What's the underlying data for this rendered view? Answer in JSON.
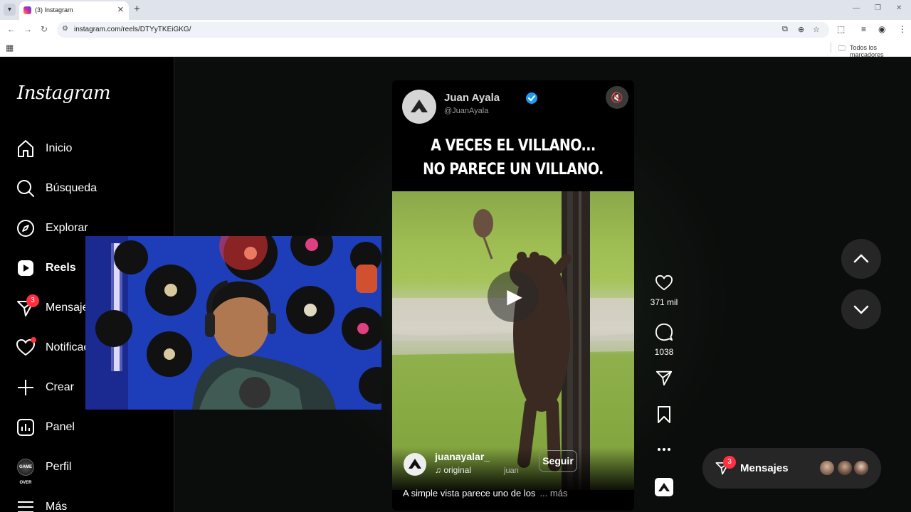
{
  "browser": {
    "tab_title": "(3) Instagram",
    "new_tab": "+",
    "url": "instagram.com/reels/DTYyTKEiGKG/",
    "bookmarks_label": "Todos los marcadores"
  },
  "sidebar": {
    "logo": "Instagram",
    "items": [
      {
        "label": "Inicio"
      },
      {
        "label": "Búsqueda"
      },
      {
        "label": "Explorar"
      },
      {
        "label": "Reels"
      },
      {
        "label": "Mensajes",
        "badge": "3"
      },
      {
        "label": "Notificaciones"
      },
      {
        "label": "Crear"
      },
      {
        "label": "Panel"
      },
      {
        "label": "Perfil",
        "avatar_text": "GAME OVER"
      },
      {
        "label": "Más"
      }
    ]
  },
  "reel": {
    "author_name": "Juan Ayala",
    "author_handle": "@JuanAyala",
    "headline_line1": "A VECES EL VILLANO...",
    "headline_line2": "NO PARECE UN VILLANO.",
    "username": "juanayalar_",
    "audio": "original",
    "audio_extra": "juan",
    "follow_label": "Seguir",
    "caption": "A simple vista parece uno de los",
    "more_label": "... más"
  },
  "actions": {
    "likes": "371 mil",
    "comments": "1038"
  },
  "messages_pill": {
    "label": "Mensajes",
    "badge": "3"
  },
  "colors": {
    "badge": "#ff3040",
    "page_bg": "#0b0d0c",
    "button_bg": "#262626",
    "verified": "#0095f6"
  }
}
